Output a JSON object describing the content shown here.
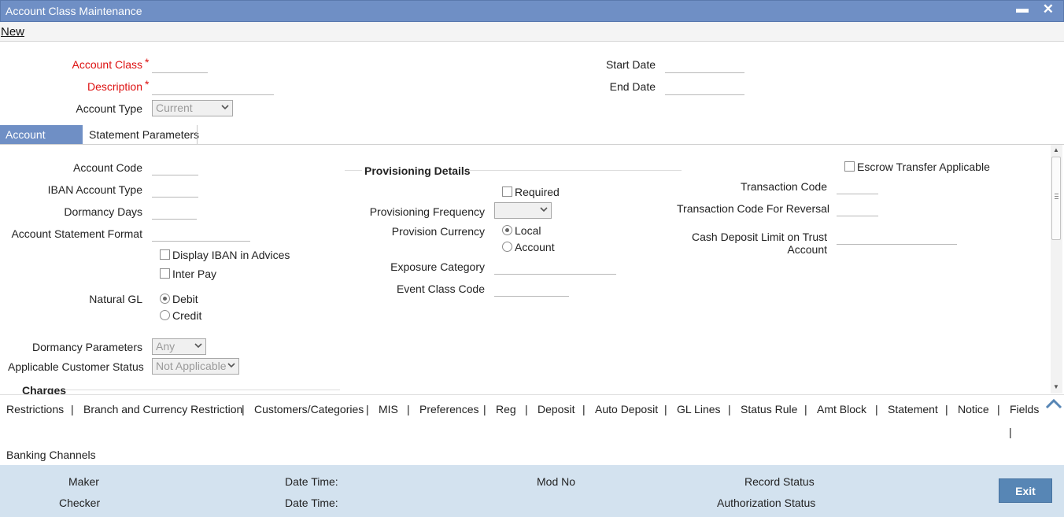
{
  "window": {
    "title": "Account Class Maintenance",
    "minimize_glyph": "▬",
    "close_glyph": "✕"
  },
  "menu": {
    "new_label": "New"
  },
  "header": {
    "account_class_label": "Account Class",
    "description_label": "Description",
    "account_type_label": "Account Type",
    "account_type_value": "Current",
    "start_date_label": "Start Date",
    "end_date_label": "End Date",
    "required_marker": "*"
  },
  "tabs": [
    {
      "label": "Account Details",
      "active": true
    },
    {
      "label": "Statement Parameters",
      "active": false
    }
  ],
  "details": {
    "account_code_label": "Account Code",
    "iban_account_type_label": "IBAN Account Type",
    "dormancy_days_label": "Dormancy Days",
    "account_statement_format_label": "Account Statement Format",
    "display_iban_label": "Display IBAN in Advices",
    "inter_pay_label": "Inter Pay",
    "natural_gl_label": "Natural GL",
    "natural_gl_options": [
      "Debit",
      "Credit"
    ],
    "natural_gl_selected": "Debit",
    "dormancy_parameters_label": "Dormancy Parameters",
    "dormancy_parameters_value": "Any",
    "applicable_customer_status_label": "Applicable Customer Status",
    "applicable_customer_status_value": "Not Applicable",
    "charges_title": "Charges"
  },
  "provisioning": {
    "title": "Provisioning Details",
    "required_label": "Required",
    "frequency_label": "Provisioning Frequency",
    "frequency_value": "",
    "currency_label": "Provision Currency",
    "currency_options": [
      "Local",
      "Account"
    ],
    "currency_selected": "Local",
    "exposure_category_label": "Exposure Category",
    "event_class_code_label": "Event Class Code"
  },
  "escrow": {
    "escrow_label": "Escrow Transfer Applicable",
    "transaction_code_label": "Transaction Code",
    "transaction_code_reversal_label": "Transaction Code For Reversal",
    "cash_deposit_limit_label_line1": "Cash Deposit Limit on Trust",
    "cash_deposit_limit_label_line2": "Account"
  },
  "subsystems": {
    "links": [
      "Restrictions",
      "Branch and Currency Restriction",
      "Customers/Categories",
      "MIS",
      "Preferences",
      "Reg",
      "Deposit",
      "Auto Deposit",
      "GL Lines",
      "Status Rule",
      "Amt Block",
      "Statement",
      "Notice",
      "Fields"
    ],
    "second_row": [
      "Banking Channels"
    ],
    "separator": "|"
  },
  "audit": {
    "maker_label": "Maker",
    "checker_label": "Checker",
    "date_time_label": "Date Time:",
    "mod_no_label": "Mod No",
    "record_status_label": "Record Status",
    "authorization_status_label": "Authorization Status",
    "exit_label": "Exit"
  },
  "colors": {
    "title_bar": "#6f8fc5",
    "audit_bar": "#d3e2ef",
    "exit_button": "#5786b5",
    "required": "#dd1111"
  }
}
